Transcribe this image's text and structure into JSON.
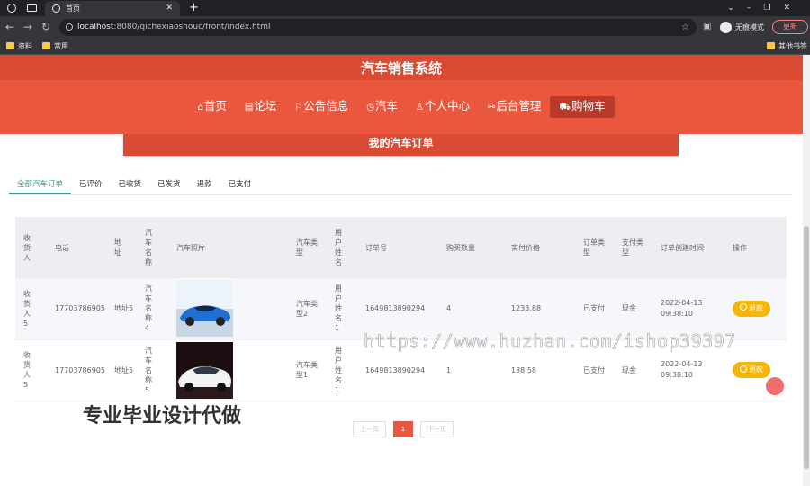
{
  "browser": {
    "tab_title": "首页",
    "url_host": "localhost",
    "url_rest": ":8080/qichexiaoshouc/front/index.html",
    "incognito_label": "无痕模式",
    "update_label": "更新",
    "bookmarks": [
      "资料",
      "常用"
    ],
    "other_bookmarks": "其他书签"
  },
  "site": {
    "title": "汽车销售系统",
    "menu": [
      {
        "icon": "home-icon",
        "glyph": "⌂",
        "label": "首页"
      },
      {
        "icon": "forum-icon",
        "glyph": "▤",
        "label": "论坛"
      },
      {
        "icon": "flag-icon",
        "glyph": "⚐",
        "label": "公告信息"
      },
      {
        "icon": "clock-icon",
        "glyph": "◷",
        "label": "汽车"
      },
      {
        "icon": "user-icon",
        "glyph": "♙",
        "label": "个人中心"
      },
      {
        "icon": "link-icon",
        "glyph": "⚯",
        "label": "后台管理"
      },
      {
        "icon": "cart-icon",
        "glyph": "⛟",
        "label": "购物车"
      }
    ]
  },
  "orders": {
    "banner": "我的汽车订单",
    "tabs": [
      "全部汽车订单",
      "已评价",
      "已收货",
      "已发货",
      "退款",
      "已支付"
    ],
    "columns": [
      "收货人",
      "电话",
      "地址",
      "汽车名称",
      "汽车照片",
      "汽车类型",
      "用户姓名",
      "订单号",
      "购买数量",
      "实付价格",
      "订单类型",
      "支付类型",
      "订单创建时间",
      "操作"
    ],
    "rows": [
      {
        "receiver": "收货人5",
        "phone": "17703786905",
        "address": "地址5",
        "car_name": "汽车名称4",
        "car_type": "汽车类型2",
        "user_name": "用户姓名1",
        "order_no": "1649813890294",
        "quantity": "4",
        "paid": "1233.88",
        "order_type": "已支付",
        "pay_type": "现金",
        "created": "2022-04-13 09:38:10",
        "action": "退款",
        "photo_color": "#1f6fd1"
      },
      {
        "receiver": "收货人5",
        "phone": "17703786905",
        "address": "地址5",
        "car_name": "汽车名称5",
        "car_type": "汽车类型1",
        "user_name": "用户姓名1",
        "order_no": "1649813890294",
        "quantity": "1",
        "paid": "138.58",
        "order_type": "已支付",
        "pay_type": "现金",
        "created": "2022-04-13 09:38:10",
        "action": "退款",
        "photo_color": "#f2f2f2"
      }
    ]
  },
  "pager": {
    "prev": "上一页",
    "current": "1",
    "next": "下一页"
  },
  "watermarks": {
    "url": "https://www.huzhan.com/ishop39397",
    "ad": "专业毕业设计代做"
  },
  "colors": {
    "brand": "#e9573f",
    "brand_dark": "#db4a33",
    "active_tab": "#3a9b8e",
    "refund": "#f5b50a"
  }
}
